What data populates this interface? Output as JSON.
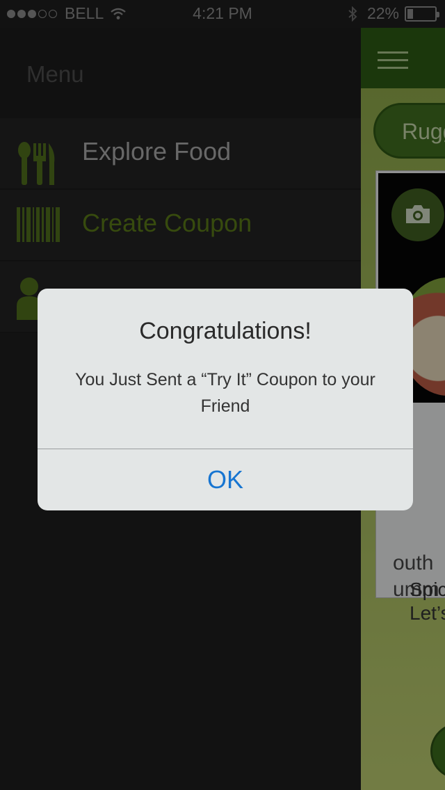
{
  "status_bar": {
    "carrier": "BELL",
    "time": "4:21 PM",
    "battery": "22%",
    "battery_level": 0.22,
    "signal_bars": 3,
    "icons": [
      "signal-dots-icon",
      "wifi-icon",
      "bluetooth-icon",
      "battery-icon"
    ]
  },
  "menu": {
    "title": "Menu",
    "items": [
      {
        "label": "Explore Food",
        "icon": "utensils-icon",
        "color": "#a8a8a8"
      },
      {
        "label": "Create Coupon",
        "icon": "barcode-icon",
        "color": "#5a7a18"
      },
      {
        "label": "",
        "icon": "user-icon",
        "color": "#5a7a18"
      }
    ]
  },
  "app": {
    "pill_label": "Rugg",
    "card_text": [
      "outh",
      "umm"
    ],
    "card_title": [
      "Spicy",
      "Let’s"
    ],
    "accent_color": "#2c5a14"
  },
  "alert": {
    "title": "Congratulations!",
    "message": "You Just Sent a “Try It” Coupon to your Friend",
    "ok_label": "OK",
    "ok_color": "#1775d1"
  }
}
